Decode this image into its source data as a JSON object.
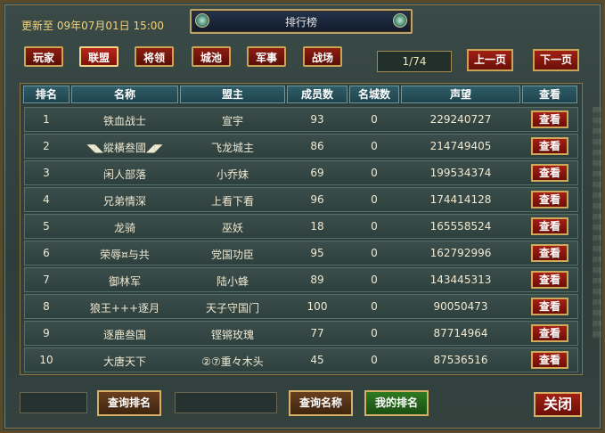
{
  "header": {
    "update_text": "更新至 09年07月01日 15:00",
    "title": "排行榜"
  },
  "tabs": [
    {
      "label": "玩家"
    },
    {
      "label": "联盟",
      "active": true
    },
    {
      "label": "将领"
    },
    {
      "label": "城池"
    },
    {
      "label": "军事"
    },
    {
      "label": "战场"
    }
  ],
  "pager": {
    "page_text": "1/74",
    "prev_label": "上一页",
    "next_label": "下一页"
  },
  "table": {
    "columns": [
      "排名",
      "名称",
      "盟主",
      "成员数",
      "名城数",
      "声望",
      "查看"
    ],
    "view_label": "查看",
    "rows": [
      {
        "rank": "1",
        "name": "铁血战士",
        "leader": "宣宇",
        "members": "93",
        "cities": "0",
        "prestige": "229240727"
      },
      {
        "rank": "2",
        "name": "◥◣縱橫叁國◢◤",
        "leader": "飞龙城主",
        "members": "86",
        "cities": "0",
        "prestige": "214749405"
      },
      {
        "rank": "3",
        "name": "闲人部落",
        "leader": "小乔妹",
        "members": "69",
        "cities": "0",
        "prestige": "199534374"
      },
      {
        "rank": "4",
        "name": "兄弟情深",
        "leader": "上看下看",
        "members": "96",
        "cities": "0",
        "prestige": "174414128"
      },
      {
        "rank": "5",
        "name": "龙骑",
        "leader": "巫妖",
        "members": "18",
        "cities": "0",
        "prestige": "165558524"
      },
      {
        "rank": "6",
        "name": "荣辱¤与共",
        "leader": "党国功臣",
        "members": "95",
        "cities": "0",
        "prestige": "162792996"
      },
      {
        "rank": "7",
        "name": "御林军",
        "leader": "陆小蜂",
        "members": "89",
        "cities": "0",
        "prestige": "143445313"
      },
      {
        "rank": "8",
        "name": "狼王+++逐月",
        "leader": "天子守国门",
        "members": "100",
        "cities": "0",
        "prestige": "90050473"
      },
      {
        "rank": "9",
        "name": "逐鹿叁国",
        "leader": "铿锵玫瑰",
        "members": "77",
        "cities": "0",
        "prestige": "87714964"
      },
      {
        "rank": "10",
        "name": "大唐天下",
        "leader": "②⑦重々木头",
        "members": "45",
        "cities": "0",
        "prestige": "87536516"
      }
    ]
  },
  "footer": {
    "query_rank_label": "查询排名",
    "query_name_label": "查询名称",
    "my_rank_label": "我的排名",
    "close_label": "关闭"
  }
}
